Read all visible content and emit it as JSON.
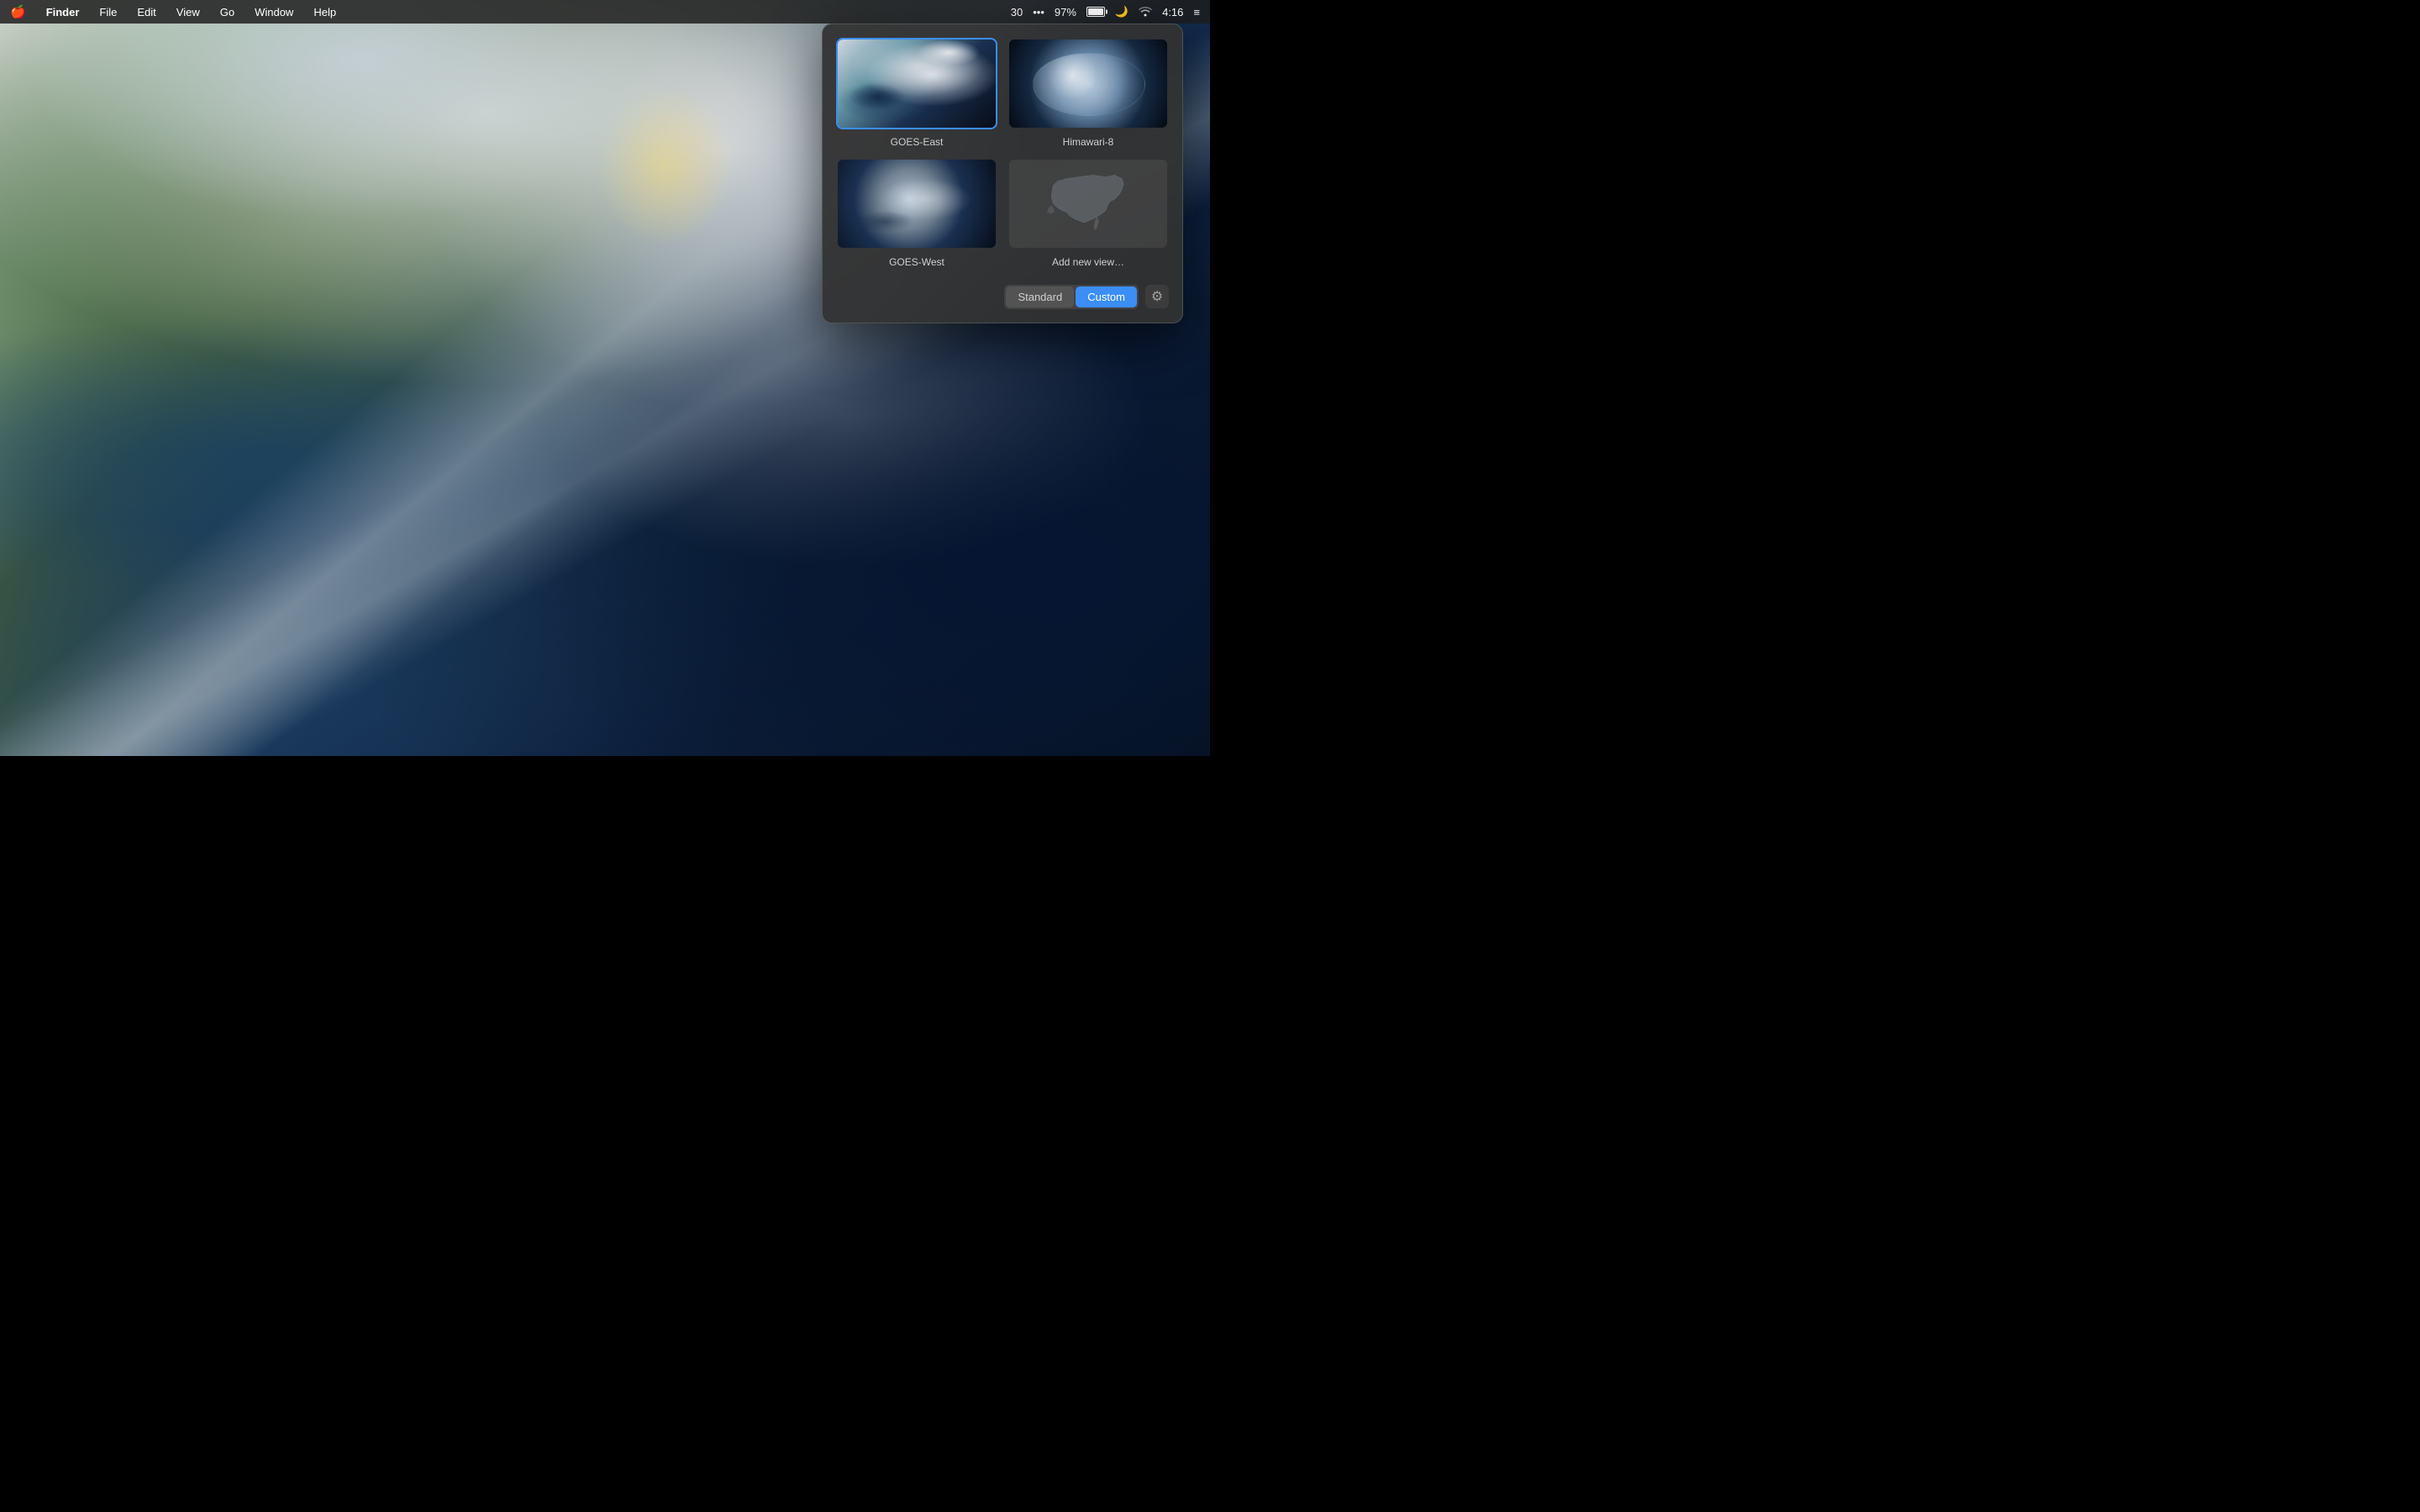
{
  "menubar": {
    "apple": "🍎",
    "app_name": "Finder",
    "items": [
      "File",
      "Edit",
      "View",
      "Go",
      "Window",
      "Help"
    ],
    "right": {
      "calendar": "30",
      "dots": "•••",
      "battery_pct": "97%",
      "wifi": "WiFi",
      "time": "4:16"
    }
  },
  "popup": {
    "satellites": [
      {
        "id": "goes-east",
        "label": "GOES-East",
        "selected": true
      },
      {
        "id": "himawari",
        "label": "Himawari-8",
        "selected": false
      },
      {
        "id": "goes-west",
        "label": "GOES-West",
        "selected": false
      },
      {
        "id": "add-new",
        "label": "Add new view…",
        "selected": false
      }
    ],
    "toggle": {
      "standard_label": "Standard",
      "custom_label": "Custom",
      "active": "custom"
    },
    "gear_icon": "⚙"
  }
}
